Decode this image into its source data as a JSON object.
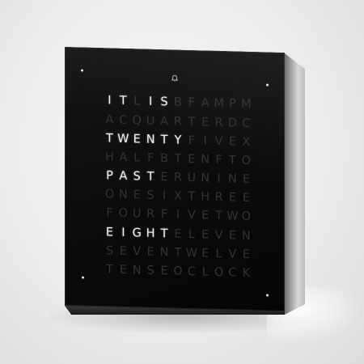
{
  "colors": {
    "face": "#0b0b0b",
    "lit_letter": "#f4f4f4",
    "dim_letter": "#343434",
    "background": "#ececec"
  },
  "icons": {
    "alarm": "bell-icon"
  },
  "word_clock": {
    "rows": [
      {
        "letters": [
          "I",
          "T",
          "L",
          "I",
          "S",
          "B",
          "F",
          "A",
          "M",
          "P",
          "M"
        ],
        "lit": [
          0,
          1,
          3,
          4
        ]
      },
      {
        "letters": [
          "A",
          "C",
          "Q",
          "U",
          "A",
          "R",
          "T",
          "E",
          "R",
          "D",
          "C"
        ],
        "lit": []
      },
      {
        "letters": [
          "T",
          "W",
          "E",
          "N",
          "T",
          "Y",
          "F",
          "I",
          "V",
          "E",
          "X"
        ],
        "lit": [
          0,
          1,
          2,
          3,
          4,
          5
        ]
      },
      {
        "letters": [
          "H",
          "A",
          "L",
          "F",
          "B",
          "T",
          "E",
          "N",
          "F",
          "T",
          "O"
        ],
        "lit": []
      },
      {
        "letters": [
          "P",
          "A",
          "S",
          "T",
          "E",
          "R",
          "U",
          "N",
          "I",
          "N",
          "E"
        ],
        "lit": [
          0,
          1,
          2,
          3
        ]
      },
      {
        "letters": [
          "O",
          "N",
          "E",
          "S",
          "I",
          "X",
          "T",
          "H",
          "R",
          "E",
          "E"
        ],
        "lit": []
      },
      {
        "letters": [
          "F",
          "O",
          "U",
          "R",
          "F",
          "I",
          "V",
          "E",
          "T",
          "W",
          "O"
        ],
        "lit": []
      },
      {
        "letters": [
          "E",
          "I",
          "G",
          "H",
          "T",
          "E",
          "L",
          "E",
          "V",
          "E",
          "N"
        ],
        "lit": [
          0,
          1,
          2,
          3,
          4
        ]
      },
      {
        "letters": [
          "S",
          "E",
          "V",
          "E",
          "N",
          "T",
          "W",
          "E",
          "L",
          "V",
          "E"
        ],
        "lit": []
      },
      {
        "letters": [
          "T",
          "E",
          "N",
          "S",
          "E",
          "O",
          "C",
          "L",
          "O",
          "C",
          "K"
        ],
        "lit": []
      }
    ]
  }
}
